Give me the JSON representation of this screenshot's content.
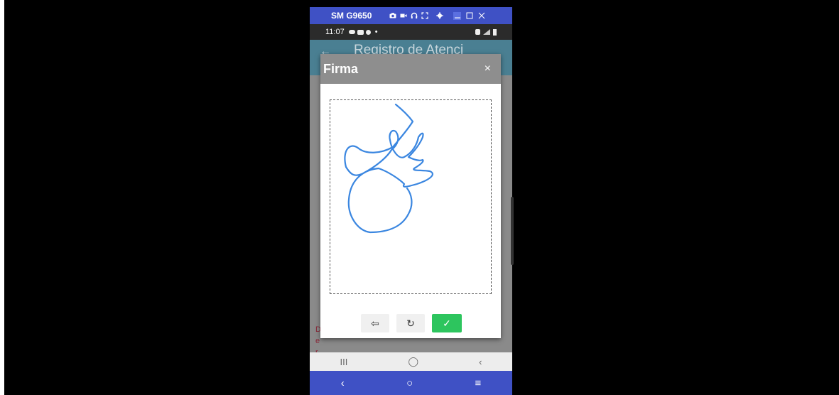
{
  "mirror_window": {
    "title": "SM G9650",
    "toolbar_icons": [
      "camera-icon",
      "video-icon",
      "headphones-icon",
      "fullscreen-icon",
      "settings-icon"
    ],
    "window_controls": [
      "minimize-icon",
      "maximize-icon",
      "close-icon"
    ],
    "nav": {
      "back": "‹",
      "home": "○",
      "menu": "≡"
    }
  },
  "status_bar": {
    "time": "11:07",
    "left_icons": [
      "cloud-icon",
      "youtube-icon",
      "chat-icon"
    ],
    "dot": "•",
    "right_icons": [
      "alarm-icon",
      "signal-icon",
      "battery-icon"
    ]
  },
  "app": {
    "header_title": "Registro de Atenci",
    "back_icon": "←",
    "background_error_text": "D e r"
  },
  "modal": {
    "title": "Firma",
    "close_label": "×",
    "buttons": {
      "undo": "⇦",
      "clear": "↻",
      "confirm": "✓"
    },
    "accent_color": "#2dc55e"
  },
  "android_nav": {
    "recents": "III",
    "home": "◯",
    "back": "‹"
  },
  "colors": {
    "mirror_bar": "#3f51c5",
    "modal_header": "#8e8e8e",
    "signature_stroke": "#3a86e0"
  }
}
